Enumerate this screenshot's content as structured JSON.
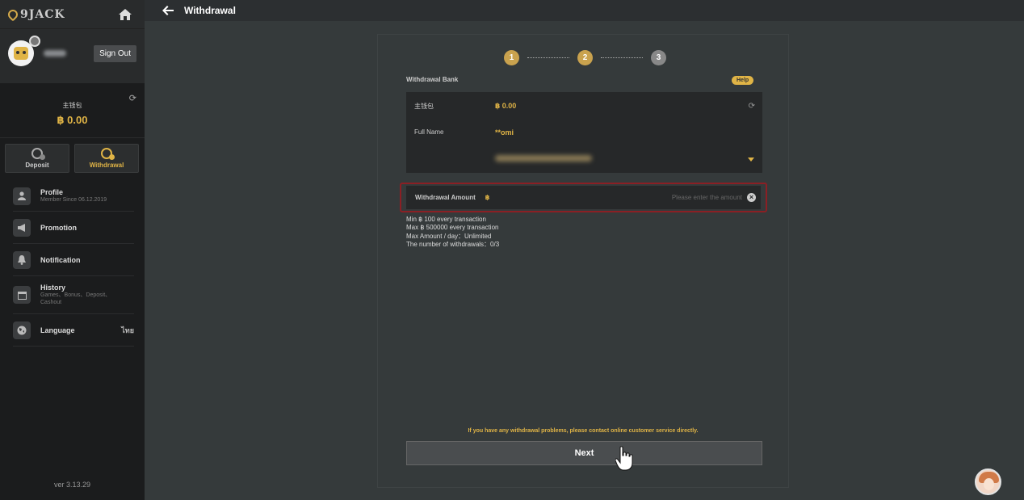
{
  "sidebar": {
    "logo_text": "9JACK",
    "sign_out_label": "Sign Out",
    "wallet": {
      "label": "主钱包",
      "amount": "฿ 0.00"
    },
    "actions": [
      {
        "label": "Deposit",
        "icon": "coin-deposit-icon"
      },
      {
        "label": "Withdrawal",
        "icon": "coin-withdrawal-icon"
      }
    ],
    "menu": [
      {
        "title": "Profile",
        "subtitle": "Member Since 06.12.2019",
        "icon": "user-icon"
      },
      {
        "title": "Promotion",
        "subtitle": "",
        "icon": "megaphone-icon"
      },
      {
        "title": "Notification",
        "subtitle": "",
        "icon": "bell-icon"
      },
      {
        "title": "History",
        "subtitle": "Games、Bonus、Deposit、Cashout",
        "icon": "calendar-icon"
      },
      {
        "title": "Language",
        "subtitle": "",
        "right": "ไทย",
        "icon": "globe-icon"
      }
    ],
    "version": "ver 3.13.29"
  },
  "header": {
    "title": "Withdrawal"
  },
  "steps": [
    "1",
    "2",
    "3"
  ],
  "form": {
    "bank_label": "Withdrawal Bank",
    "help_label": "Help",
    "wallet_label": "主钱包",
    "wallet_value": "฿ 0.00",
    "fullname_label": "Full Name",
    "fullname_value": "**omi",
    "amount_label": "Withdrawal Amount",
    "amount_currency": "฿",
    "amount_placeholder": "Please enter the amount",
    "rules": [
      "Min ฿ 100 every transaction",
      "Max ฿ 500000 every transaction",
      "Max Amount / day：Unlimited",
      "The number of withdrawals：0/3"
    ],
    "notice": "If you have any withdrawal problems, please contact online customer service directly.",
    "next_label": "Next"
  },
  "colors": {
    "accent": "#e0b446",
    "error_border": "#8b1f24",
    "background": "#353a3b",
    "sidebar": "#1b1c1d"
  }
}
